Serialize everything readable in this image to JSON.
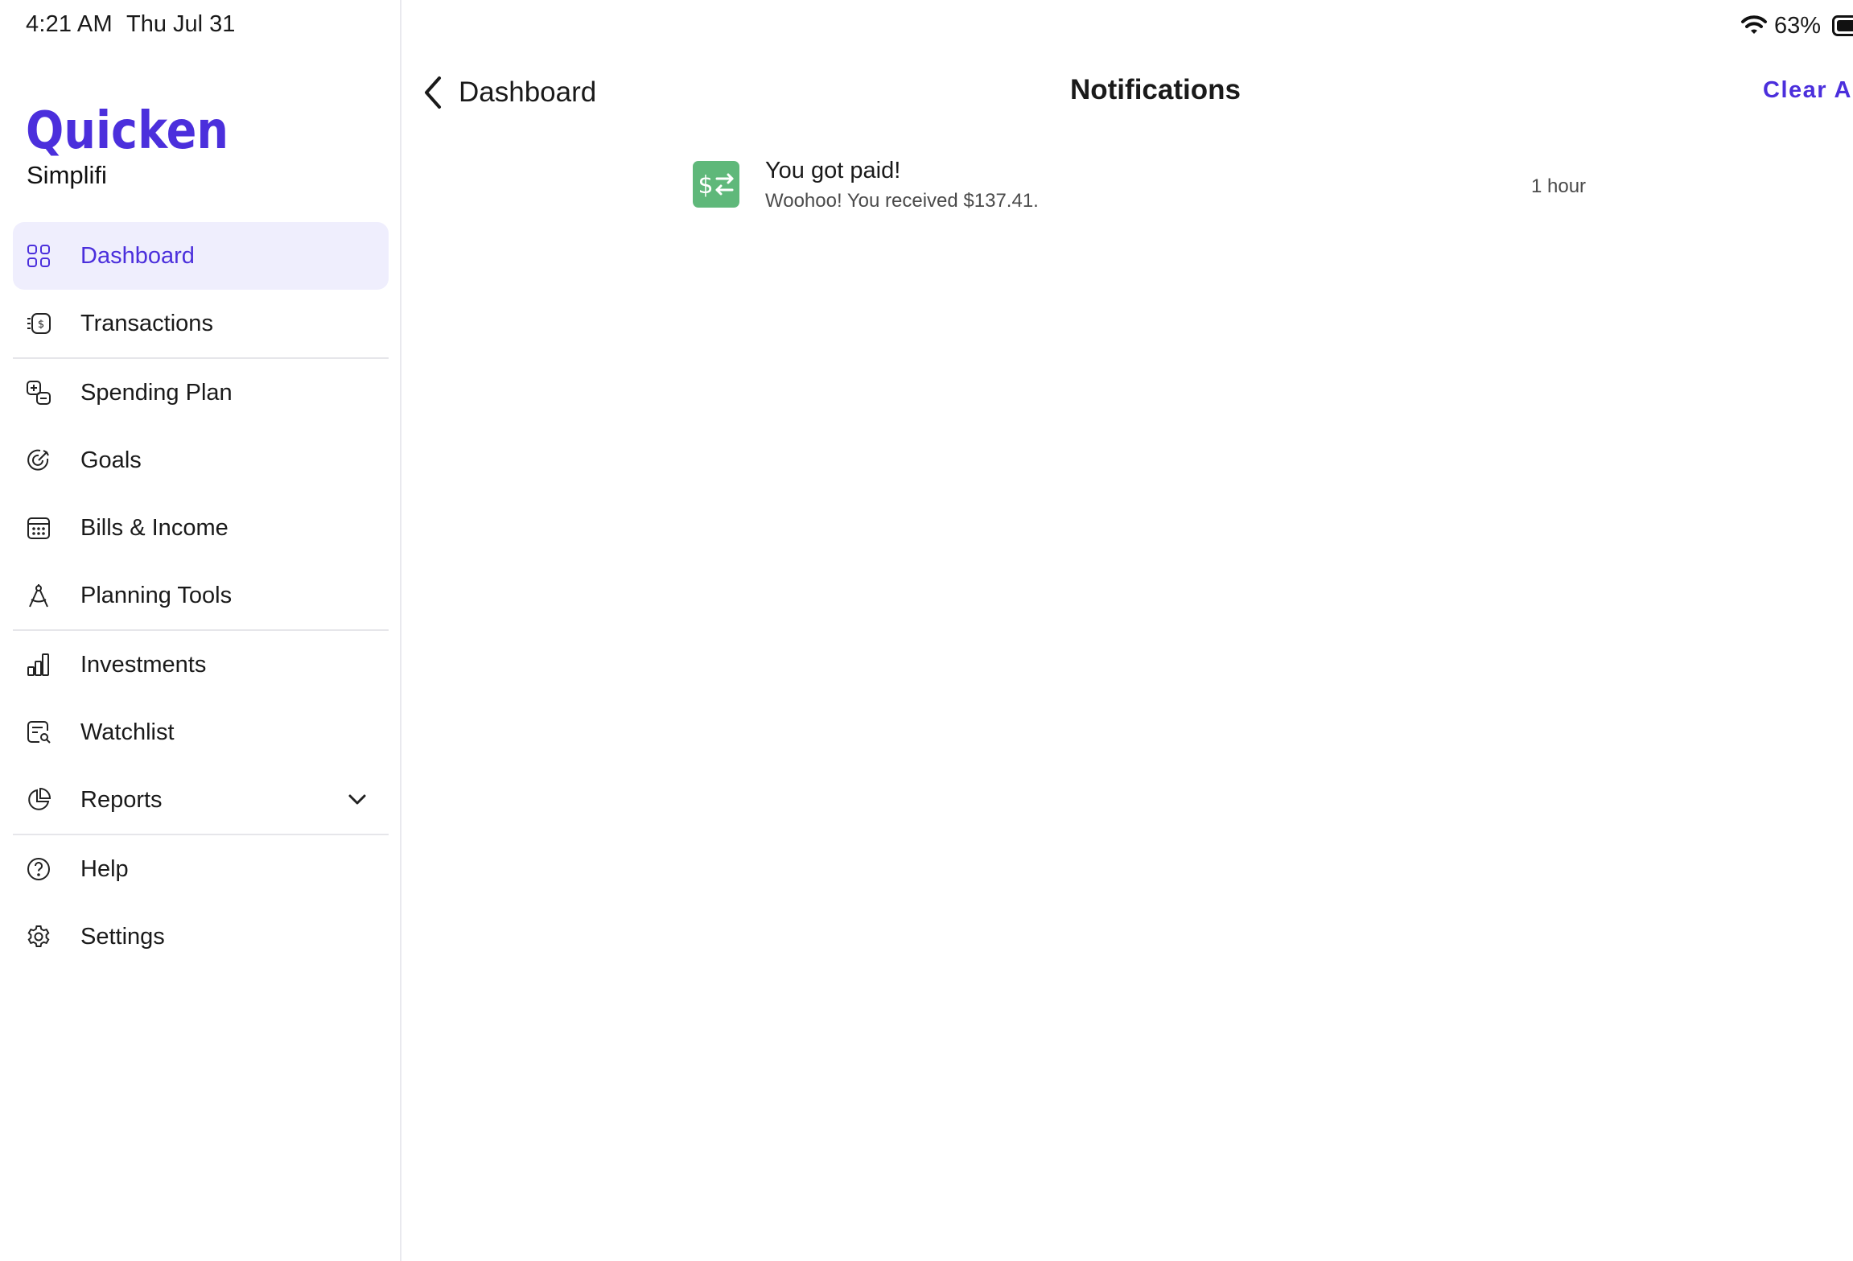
{
  "status_bar": {
    "time": "4:21 AM",
    "date": "Thu Jul 31",
    "battery_percent": "63%",
    "wifi_icon": "wifi-icon",
    "battery_icon": "battery-icon"
  },
  "brand": {
    "name": "Quicken",
    "subtitle": "Simplifi",
    "color": "#4b2fdc"
  },
  "sidebar": {
    "active_bg": "#efeefd",
    "active_color": "#4b2fdc",
    "items": [
      {
        "label": "Dashboard",
        "icon": "grid-icon",
        "active": true
      },
      {
        "label": "Transactions",
        "icon": "money-icon"
      },
      {
        "label": "Spending Plan",
        "icon": "plan-icon"
      },
      {
        "label": "Goals",
        "icon": "target-icon"
      },
      {
        "label": "Bills & Income",
        "icon": "calendar-icon"
      },
      {
        "label": "Planning Tools",
        "icon": "compass-icon"
      },
      {
        "label": "Investments",
        "icon": "bar-chart-icon"
      },
      {
        "label": "Watchlist",
        "icon": "watchlist-icon"
      },
      {
        "label": "Reports",
        "icon": "pie-chart-icon",
        "expandable": true
      },
      {
        "label": "Help",
        "icon": "help-icon"
      },
      {
        "label": "Settings",
        "icon": "gear-icon"
      }
    ]
  },
  "header": {
    "back_label": "Dashboard",
    "title": "Notifications",
    "clear_all_label": "Clear All"
  },
  "notifications": [
    {
      "icon": "money-transfer-icon",
      "icon_color": "#5fb87a",
      "title": "You got paid!",
      "body": "Woohoo! You received $137.41.",
      "time": "1 hour"
    }
  ]
}
